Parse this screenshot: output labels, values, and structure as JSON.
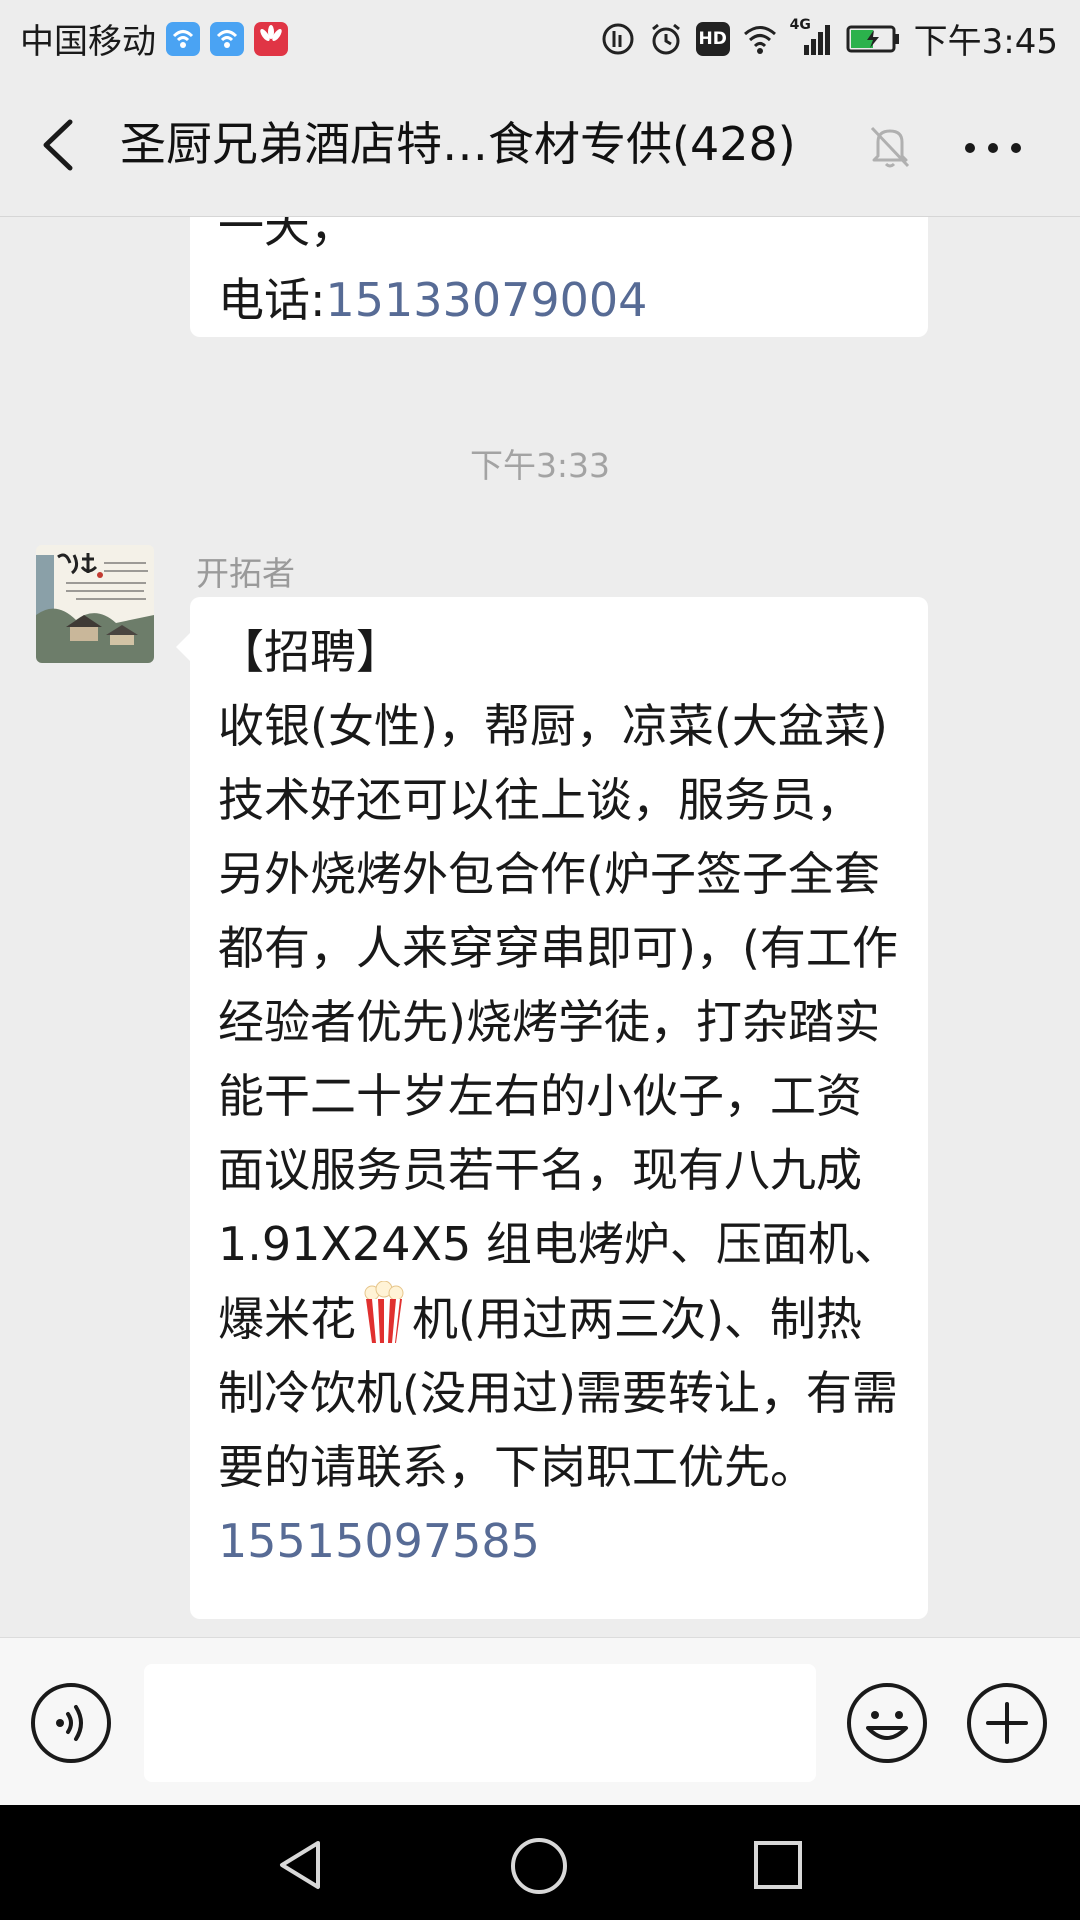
{
  "status_bar": {
    "carrier": "中国移动",
    "chip_hd": "HD",
    "network": "4G",
    "time": "下午3:45"
  },
  "header": {
    "title": "圣厨兄弟酒店特…食材专供(428)",
    "icons": [
      "back-arrow-icon",
      "mute-bell-icon",
      "more-dots-icon"
    ]
  },
  "messages": {
    "previous": {
      "line1": "一天，",
      "phone_label": "电话:",
      "phone": "15133079004"
    },
    "time_separator": "下午3:33",
    "current": {
      "sender": "开拓者",
      "heading": "【招聘】",
      "body_before_emoji": "收银(女性)，帮厨，凉菜(大盆菜)技术好还可以往上谈，服务员，另外烧烤外包合作(炉子签子全套都有，人来穿穿串即可)，(有工作经验者优先)烧烤学徒，打杂踏实能干二十岁左右的小伙子，工资面议服务员若干名，现有八九成 1.91X24X5 组电烤炉、压面机、爆米花",
      "emoji": "popcorn",
      "body_after_emoji": "机(用过两三次)、制热制冷饮机(没用过)需要转让，有需要的请联系，下岗职工优先。",
      "phone": "15515097585"
    }
  },
  "input_bar": {
    "placeholder": "",
    "icons": [
      "voice-icon",
      "emoji-icon",
      "plus-icon"
    ]
  },
  "nav_bar": {
    "icons": [
      "nav-back-icon",
      "nav-home-icon",
      "nav-recent-icon"
    ]
  },
  "colors": {
    "background": "#ededed",
    "bubble": "#ffffff",
    "link": "#576b95",
    "muted_text": "#a3a3a3"
  }
}
